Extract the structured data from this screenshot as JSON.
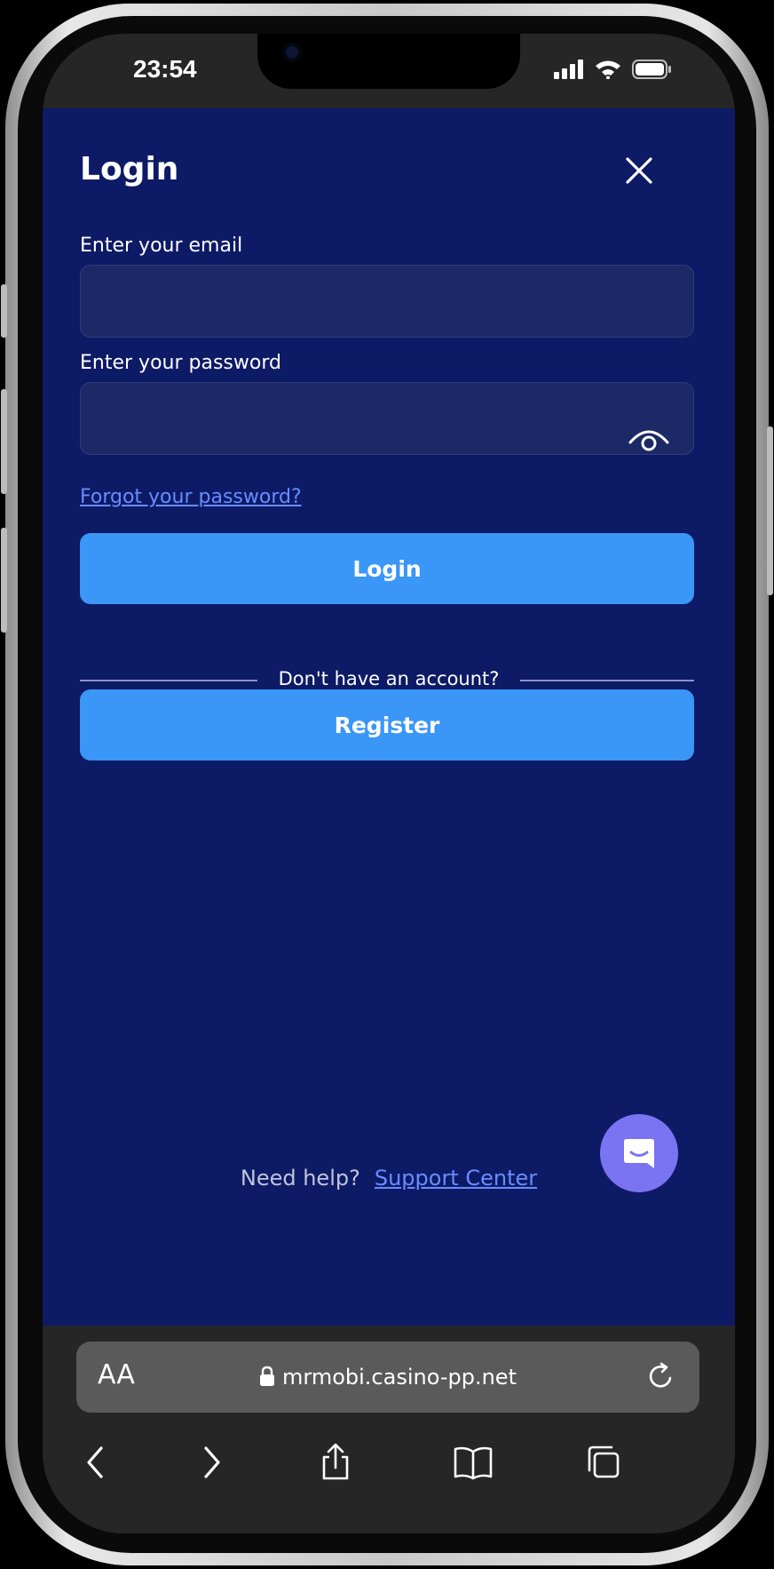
{
  "status_bar": {
    "time": "23:54"
  },
  "login": {
    "title": "Login",
    "email_label": "Enter your email",
    "email_value": "",
    "password_label": "Enter your password",
    "password_value": "",
    "forgot_link": "Forgot your password?",
    "login_button": "Login",
    "divider_text": "Don't have an account?",
    "register_button": "Register"
  },
  "help": {
    "question": "Need help?",
    "link": "Support Center"
  },
  "browser": {
    "text_size_button": "AA",
    "url": "mrmobi.casino-pp.net"
  },
  "icons": {
    "close": "close-icon",
    "eye": "eye-icon",
    "chat": "chat-icon",
    "lock": "lock-icon",
    "reload": "reload-icon",
    "back": "chevron-left-icon",
    "forward": "chevron-right-icon",
    "share": "share-icon",
    "bookmarks": "book-icon",
    "tabs": "tabs-icon"
  },
  "colors": {
    "page_background": "#0d1a66",
    "input_background": "#1b2a66",
    "button": "#3a96f7",
    "link": "#6a8cff",
    "chat_bubble": "#7a73f2"
  }
}
